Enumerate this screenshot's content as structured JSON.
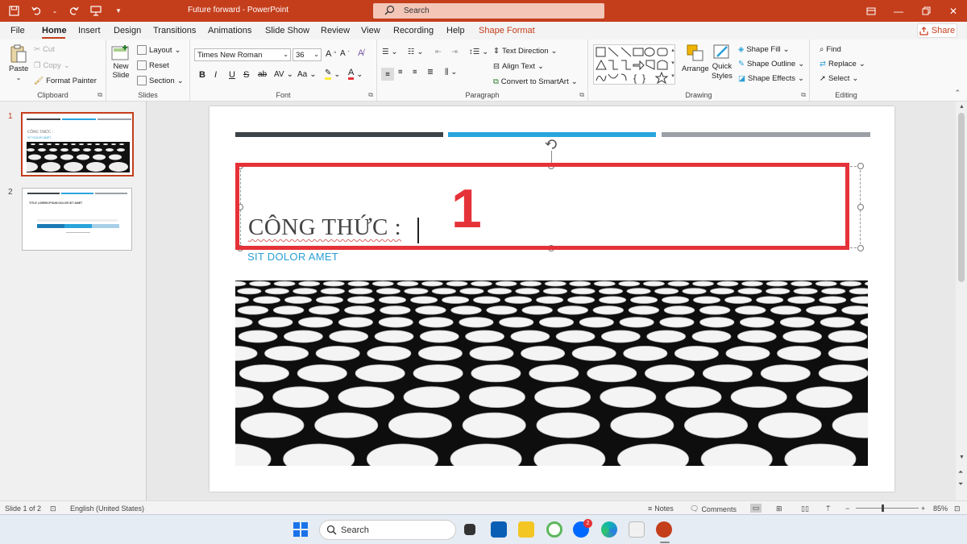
{
  "window": {
    "title": "Future forward  -  PowerPoint",
    "search_placeholder": "Search"
  },
  "menu": {
    "tabs": [
      "File",
      "Home",
      "Insert",
      "Design",
      "Transitions",
      "Animations",
      "Slide Show",
      "Review",
      "View",
      "Recording",
      "Help",
      "Shape Format"
    ],
    "active": "Home",
    "share": "Share"
  },
  "ribbon": {
    "clipboard": {
      "label": "Clipboard",
      "paste": "Paste",
      "cut": "Cut",
      "copy": "Copy",
      "format_painter": "Format Painter"
    },
    "slides": {
      "label": "Slides",
      "new_slide": "New",
      "new_slide2": "Slide",
      "layout": "Layout",
      "reset": "Reset",
      "section": "Section"
    },
    "font": {
      "label": "Font",
      "font_name": "Times New Roman",
      "font_size": "36",
      "bold": "B",
      "italic": "I",
      "underline": "U",
      "strike": "S",
      "shadow": "ab",
      "spacing": "AV",
      "case": "Aa"
    },
    "paragraph": {
      "label": "Paragraph",
      "text_direction": "Text Direction",
      "align_text": "Align Text",
      "convert_smartart": "Convert to SmartArt"
    },
    "drawing": {
      "label": "Drawing",
      "arrange": "Arrange",
      "quick_styles": "Quick",
      "quick_styles2": "Styles",
      "shape_fill": "Shape Fill",
      "shape_outline": "Shape Outline",
      "shape_effects": "Shape Effects"
    },
    "editing": {
      "label": "Editing",
      "find": "Find",
      "replace": "Replace",
      "select": "Select"
    }
  },
  "thumbnails": [
    {
      "num": "1",
      "title": "CÔNG THỨC :",
      "sub": "SIT DOLOR AMET"
    },
    {
      "num": "2",
      "title": "TITLE LOREM IPSUM DOLOR SIT AMET"
    }
  ],
  "slide": {
    "title": "CÔNG THỨC :",
    "annotation": "1",
    "subtitle": "SIT DOLOR AMET",
    "bar_colors": [
      "#3d4449",
      "#29a5dc",
      "#9aa0a6"
    ]
  },
  "status": {
    "slide_info": "Slide 1 of 2",
    "language": "English (United States)",
    "notes": "Notes",
    "comments": "Comments",
    "zoom": "85%"
  },
  "taskbar": {
    "search": "Search",
    "badge": "2"
  }
}
